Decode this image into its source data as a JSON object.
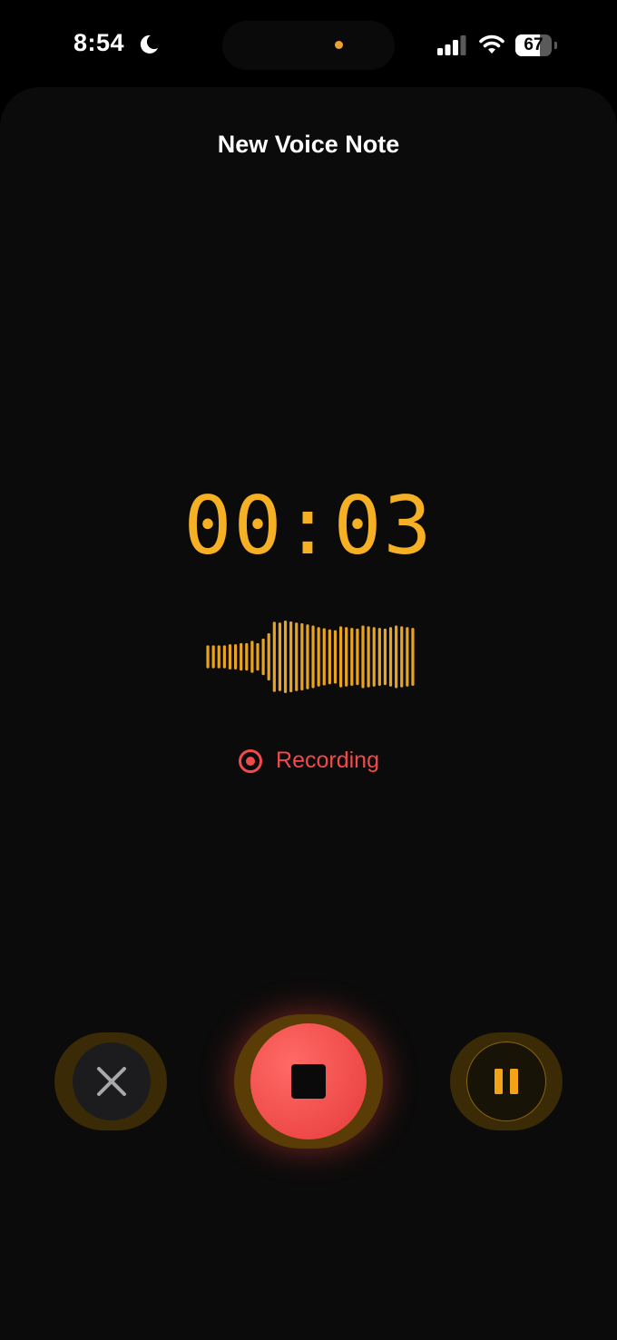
{
  "status_bar": {
    "time": "8:54",
    "battery_level": "67",
    "battery_fraction": 0.67,
    "icons": [
      "moon-icon",
      "cellular-signal-icon",
      "wifi-icon",
      "battery-icon"
    ]
  },
  "sheet": {
    "title": "New Voice Note"
  },
  "timer": {
    "elapsed": "00:03"
  },
  "waveform": {
    "color": "#e8a41f",
    "levels": [
      0.3,
      0.3,
      0.3,
      0.3,
      0.33,
      0.33,
      0.36,
      0.36,
      0.42,
      0.36,
      0.48,
      0.62,
      0.92,
      0.9,
      0.95,
      0.93,
      0.9,
      0.88,
      0.85,
      0.82,
      0.78,
      0.75,
      0.72,
      0.7,
      0.8,
      0.78,
      0.76,
      0.74,
      0.82,
      0.8,
      0.78,
      0.76,
      0.74,
      0.78,
      0.82,
      0.8,
      0.78,
      0.76
    ]
  },
  "recording_status": {
    "label": "Recording",
    "color": "#f04a4a",
    "icon": "record-icon"
  },
  "controls": {
    "cancel": {
      "icon": "close-icon"
    },
    "stop": {
      "icon": "stop-icon",
      "color": "#f24e4e"
    },
    "pause": {
      "icon": "pause-icon",
      "color": "#f2a416"
    }
  }
}
